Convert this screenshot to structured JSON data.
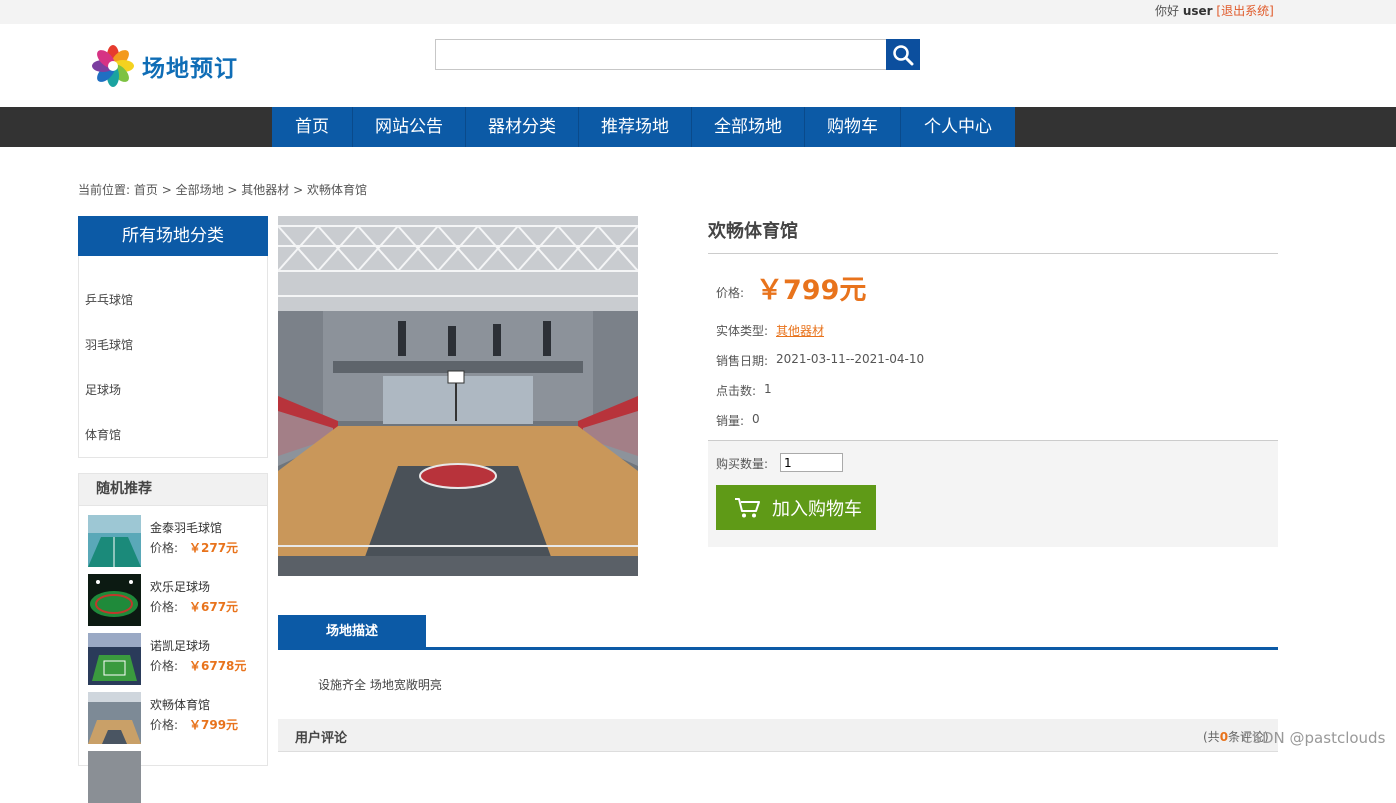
{
  "topbar": {
    "greeting": "你好",
    "username": "user",
    "logout": "[退出系统]"
  },
  "brand": {
    "name": "场地预订",
    "logo_icon": "colorful-flower-logo"
  },
  "search": {
    "placeholder": "",
    "button_icon": "search-icon"
  },
  "nav": [
    {
      "label": "首页"
    },
    {
      "label": "网站公告"
    },
    {
      "label": "器材分类"
    },
    {
      "label": "推荐场地"
    },
    {
      "label": "全部场地"
    },
    {
      "label": "购物车"
    },
    {
      "label": "个人中心"
    }
  ],
  "breadcrumb": {
    "prefix": "当前位置: ",
    "items": [
      "首页",
      "全部场地",
      "其他器材",
      "欢畅体育馆"
    ],
    "separator": " > "
  },
  "sidebar": {
    "title": "所有场地分类",
    "categories": [
      "乒乓球馆",
      "羽毛球馆",
      "足球场",
      "体育馆"
    ],
    "recommend_title": "随机推荐",
    "price_label": "价格:",
    "recommend": [
      {
        "name": "金泰羽毛球馆",
        "price": "￥277元"
      },
      {
        "name": "欢乐足球场",
        "price": "￥677元"
      },
      {
        "name": "诺凯足球场",
        "price": "￥6778元"
      },
      {
        "name": "欢畅体育馆",
        "price": "￥799元"
      }
    ]
  },
  "product": {
    "title": "欢畅体育馆",
    "price_label": "价格:",
    "price": "￥799元",
    "type_label": "实体类型:",
    "type_value": "其他器材",
    "date_label": "销售日期:",
    "date_value": "2021-03-11--2021-04-10",
    "clicks_label": "点击数:",
    "clicks_value": "1",
    "sales_label": "销量:",
    "sales_value": "0",
    "qty_label": "购买数量:",
    "qty_value": "1",
    "cart_button": "加入购物车",
    "cart_icon": "shopping-cart-icon"
  },
  "description": {
    "tab": "场地描述",
    "text": "设施齐全  场地宽敞明亮"
  },
  "reviews": {
    "title": "用户评论",
    "count_prefix": "(共",
    "count": "0",
    "count_suffix": "条评论)"
  },
  "watermark": "CSDN @pastclouds",
  "colors": {
    "primary_blue": "#0c5aa6",
    "accent_orange": "#e8731c",
    "cart_green": "#5f9a17",
    "nav_dark": "#333333"
  }
}
